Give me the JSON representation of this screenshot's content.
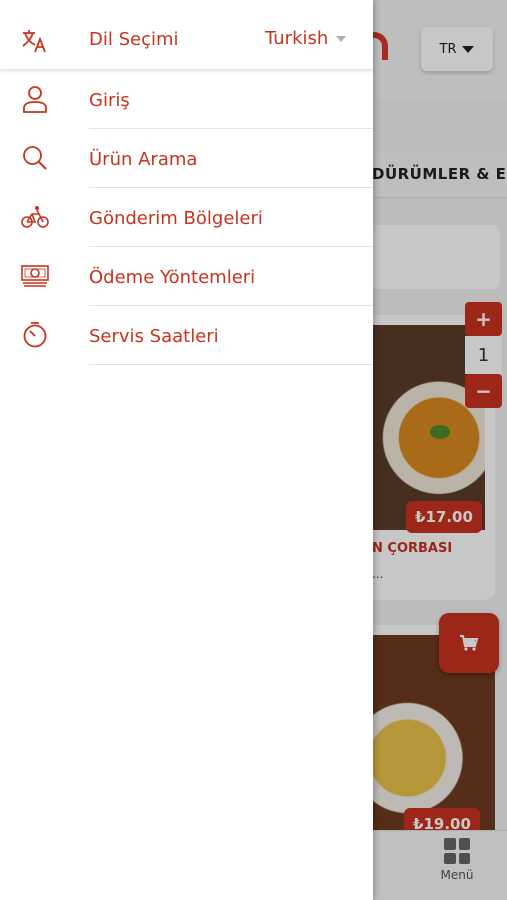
{
  "drawer": {
    "language": {
      "label": "Dil Seçimi",
      "value": "Turkish",
      "icon": "translate-icon"
    },
    "items": [
      {
        "label": "Giriş",
        "icon": "user-icon"
      },
      {
        "label": "Ürün Arama",
        "icon": "search-icon"
      },
      {
        "label": "Gönderim Bölgeleri",
        "icon": "bicycle-icon"
      },
      {
        "label": "Ödeme Yöntemleri",
        "icon": "money-icon"
      },
      {
        "label": "Servis Saatleri",
        "icon": "timer-icon"
      }
    ]
  },
  "background": {
    "lang_button": "TR",
    "category": "DÜRÜMLER & EK",
    "products": [
      {
        "name": "N ÇORBASI",
        "desc": "...",
        "price": "₺17.00"
      },
      {
        "price": "₺19.00"
      }
    ],
    "stepper": {
      "plus": "+",
      "value": "1",
      "minus": "−"
    },
    "bottom_nav": {
      "menu_label": "Menü"
    }
  },
  "colors": {
    "accent": "#c8331f",
    "drawer_bg": "#ffffff"
  }
}
